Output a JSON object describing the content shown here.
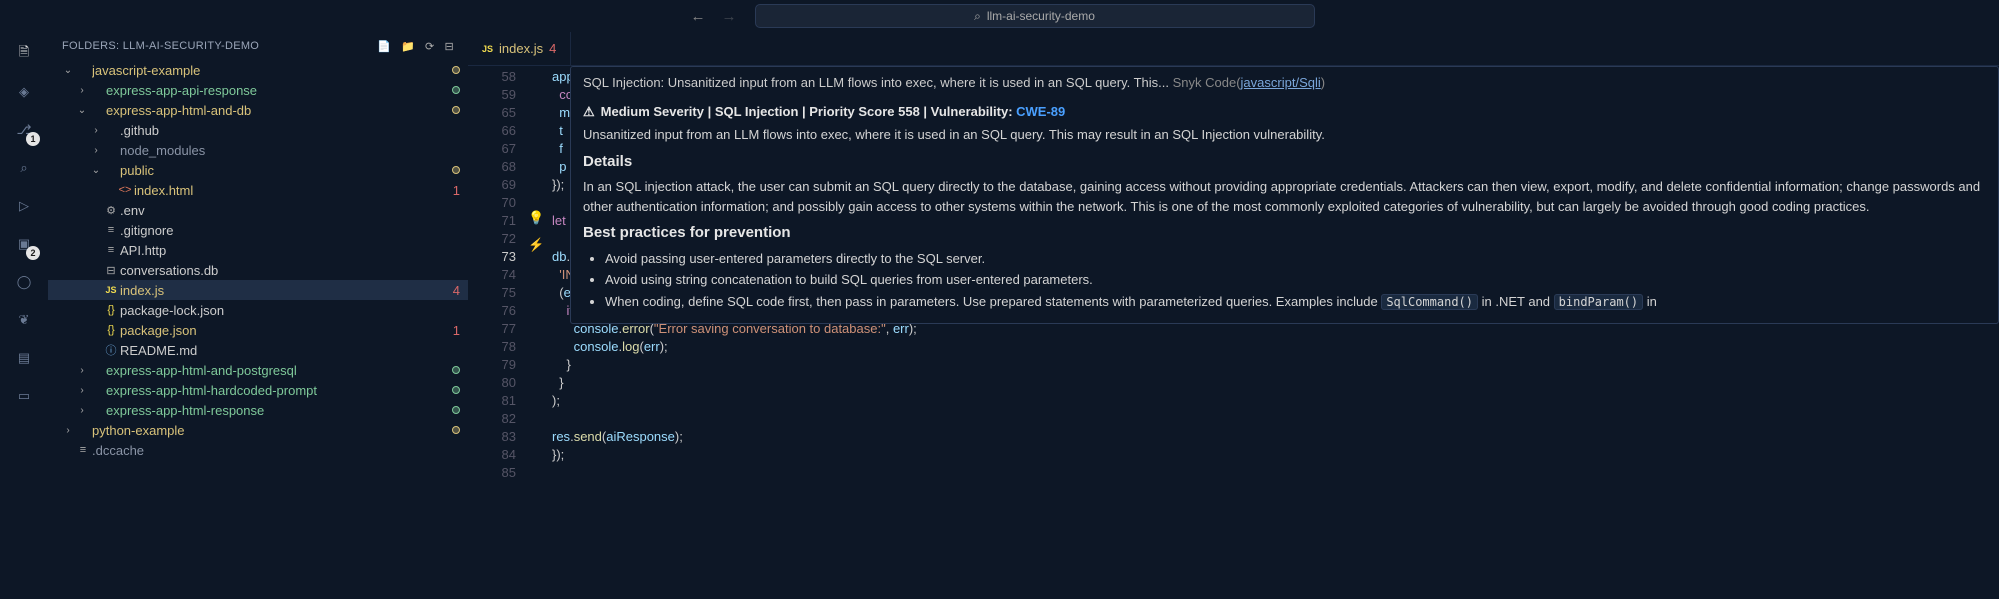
{
  "titlebar": {
    "search_text": "llm-ai-security-demo"
  },
  "activity": {
    "items": [
      {
        "name": "explorer",
        "badge": null,
        "active": true
      },
      {
        "name": "snyk",
        "badge": null
      },
      {
        "name": "source-control",
        "badge": "1"
      },
      {
        "name": "search",
        "badge": null
      },
      {
        "name": "run",
        "badge": null
      },
      {
        "name": "extensions",
        "badge": "2"
      },
      {
        "name": "github",
        "badge": null
      },
      {
        "name": "mongo",
        "badge": null
      },
      {
        "name": "docker",
        "badge": null
      },
      {
        "name": "remote",
        "badge": null
      }
    ]
  },
  "sidebar": {
    "title": "FOLDERS: LLM-AI-SECURITY-DEMO",
    "tree": [
      {
        "d": 0,
        "ch": "v",
        "ic": "folder",
        "label": "javascript-example",
        "cls": "yellow",
        "dot": "yellow"
      },
      {
        "d": 1,
        "ch": ">",
        "ic": "folder",
        "label": "express-app-api-response",
        "cls": "green",
        "dot": "green"
      },
      {
        "d": 1,
        "ch": "v",
        "ic": "folder",
        "label": "express-app-html-and-db",
        "cls": "yellow",
        "dot": "yellow"
      },
      {
        "d": 2,
        "ch": ">",
        "ic": "folder",
        "label": ".github",
        "cls": ""
      },
      {
        "d": 2,
        "ch": ">",
        "ic": "folder",
        "label": "node_modules",
        "cls": "grey"
      },
      {
        "d": 2,
        "ch": "v",
        "ic": "folder",
        "label": "public",
        "cls": "yellow",
        "dot": "yellow"
      },
      {
        "d": 3,
        "ch": "",
        "ic": "html",
        "label": "index.html",
        "cls": "yellow",
        "pc": "1"
      },
      {
        "d": 2,
        "ch": "",
        "ic": "gear",
        "label": ".env",
        "cls": ""
      },
      {
        "d": 2,
        "ch": "",
        "ic": "file",
        "label": ".gitignore",
        "cls": ""
      },
      {
        "d": 2,
        "ch": "",
        "ic": "file",
        "label": "API.http",
        "cls": ""
      },
      {
        "d": 2,
        "ch": "",
        "ic": "db",
        "label": "conversations.db",
        "cls": ""
      },
      {
        "d": 2,
        "ch": "",
        "ic": "js",
        "label": "index.js",
        "cls": "yellow",
        "pc": "4",
        "selected": true
      },
      {
        "d": 2,
        "ch": "",
        "ic": "json",
        "label": "package-lock.json",
        "cls": ""
      },
      {
        "d": 2,
        "ch": "",
        "ic": "json",
        "label": "package.json",
        "cls": "yellow",
        "pc": "1"
      },
      {
        "d": 2,
        "ch": "",
        "ic": "md",
        "label": "README.md",
        "cls": ""
      },
      {
        "d": 1,
        "ch": ">",
        "ic": "folder",
        "label": "express-app-html-and-postgresql",
        "cls": "green",
        "dot": "green"
      },
      {
        "d": 1,
        "ch": ">",
        "ic": "folder",
        "label": "express-app-html-hardcoded-prompt",
        "cls": "green",
        "dot": "green"
      },
      {
        "d": 1,
        "ch": ">",
        "ic": "folder",
        "label": "express-app-html-response",
        "cls": "green",
        "dot": "green"
      },
      {
        "d": 0,
        "ch": ">",
        "ic": "folder",
        "label": "python-example",
        "cls": "yellow",
        "dot": "yellow"
      },
      {
        "d": 0,
        "ch": "",
        "ic": "file",
        "label": ".dccache",
        "cls": "grey"
      }
    ]
  },
  "tab": {
    "icon": "JS",
    "name": "index.js",
    "problems": "4"
  },
  "hover": {
    "first_line_a": "SQL Injection: Unsanitized input from an LLM flows into exec, where it is used in an SQL query. This... ",
    "first_line_b": "Snyk Code(",
    "first_line_link": "javascript/Sqli",
    "first_line_c": ")",
    "heading": "Medium Severity | SQL Injection | Priority Score 558 | Vulnerability: ",
    "cwe": "CWE-89",
    "desc": "Unsanitized input from an LLM flows into exec, where it is used in an SQL query. This may result in an SQL Injection vulnerability.",
    "details_h": "Details",
    "details_p": "In an SQL injection attack, the user can submit an SQL query directly to the database, gaining access without providing appropriate credentials. Attackers can then view, export, modify, and delete confidential information; change passwords and other authentication information; and possibly gain access to other systems within the network. This is one of the most commonly exploited categories of vulnerability, but can largely be avoided through good coding practices.",
    "bp_h": "Best practices for prevention",
    "bp": [
      "Avoid passing user-entered parameters directly to the SQL server.",
      "Avoid using string concatenation to build SQL queries from user-entered parameters."
    ],
    "bp_last_a": "When coding, define SQL code first, then pass in parameters. Use prepared statements with parameterized queries. Examples include ",
    "bp_code1": "SqlCommand()",
    "bp_mid": " in .NET and ",
    "bp_code2": "bindParam()",
    "bp_end": " in"
  },
  "code": {
    "line_start": 58,
    "highlight": 73,
    "lines": [
      {
        "n": 58,
        "html": "<span class='tok-var'>app</span><span class='tok-punc'>.</span><span class='tok-fn'>p</span>"
      },
      {
        "n": 59,
        "html": "  <span class='tok-kw'>co</span>"
      },
      {
        "n": 65,
        "html": "  <span class='tok-var'>m</span>"
      },
      {
        "n": 66,
        "html": "  <span class='tok-var'>t</span>"
      },
      {
        "n": 67,
        "html": "  <span class='tok-var'>f</span>"
      },
      {
        "n": 68,
        "html": "  <span class='tok-var'>p</span>"
      },
      {
        "n": 69,
        "html": "<span class='tok-punc'>});</span>"
      },
      {
        "n": 70,
        "html": ""
      },
      {
        "n": 71,
        "html": "<span class='tok-kw'>let</span>"
      },
      {
        "n": 72,
        "html": ""
      },
      {
        "n": 73,
        "html": "<span class='tok-var'>db</span><span class='tok-punc'>.</span><span class='sel-highlight tok-fn'>exec</span><span class='tok-punc'>(</span>"
      },
      {
        "n": 74,
        "html": "  <span class='tok-str'>'INSERT INTO conversations (ai_response) VALUES (\"'</span> <span class='tok-punc'>+</span> <span class='tok-var'>responseText</span> <span class='tok-punc'>+</span> <span class='tok-str'>'\")'</span><span class='tok-punc'>,</span>"
      },
      {
        "n": 75,
        "html": "  <span class='tok-punc'>(</span><span class='tok-var'>err</span><span class='tok-punc'>) </span><span class='tok-prop'>=&gt;</span> <span class='tok-punc'>{</span>"
      },
      {
        "n": 76,
        "html": "    <span class='tok-kw'>if</span> <span class='tok-punc'>(</span><span class='tok-var'>err</span><span class='tok-punc'>) {</span>"
      },
      {
        "n": 77,
        "html": "      <span class='tok-var'>console</span><span class='tok-punc'>.</span><span class='tok-fn'>error</span><span class='tok-punc'>(</span><span class='tok-str'>\"Error saving conversation to database:\"</span><span class='tok-punc'>, </span><span class='tok-var'>err</span><span class='tok-punc'>);</span>"
      },
      {
        "n": 78,
        "html": "      <span class='tok-var'>console</span><span class='tok-punc'>.</span><span class='tok-fn'>log</span><span class='tok-punc'>(</span><span class='tok-var'>err</span><span class='tok-punc'>);</span>"
      },
      {
        "n": 79,
        "html": "    <span class='tok-punc'>}</span>"
      },
      {
        "n": 80,
        "html": "  <span class='tok-punc'>}</span>"
      },
      {
        "n": 81,
        "html": "<span class='tok-punc'>);</span>"
      },
      {
        "n": 82,
        "html": ""
      },
      {
        "n": 83,
        "html": "<span class='tok-var'>res</span><span class='tok-punc'>.</span><span class='tok-fn'>send</span><span class='tok-punc'>(</span><span class='tok-var'>aiResponse</span><span class='tok-punc'>);</span>"
      },
      {
        "n": 84,
        "html": "<span class='tok-punc'>});</span>"
      },
      {
        "n": 85,
        "html": ""
      }
    ]
  }
}
